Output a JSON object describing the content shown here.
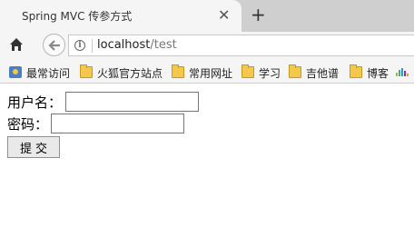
{
  "tab": {
    "title": "Spring MVC 传参方式",
    "close_glyph": "✕",
    "new_tab_glyph": "+"
  },
  "nav": {
    "url_host": "localhost",
    "url_path": "/test",
    "info_glyph": "i"
  },
  "bookmarks": [
    {
      "label": "最常访问",
      "icon": "reading-list-icon"
    },
    {
      "label": "火狐官方站点",
      "icon": "folder-icon"
    },
    {
      "label": "常用网址",
      "icon": "folder-icon"
    },
    {
      "label": "学习",
      "icon": "folder-icon"
    },
    {
      "label": "吉他谱",
      "icon": "folder-icon"
    },
    {
      "label": "博客",
      "icon": "folder-icon"
    }
  ],
  "form": {
    "username_label": "用户名：",
    "username_value": "",
    "password_label": "密码：",
    "password_value": "",
    "submit_label": "提交"
  },
  "colors": {
    "tabstrip": "#cfcfcf",
    "toolbar": "#f5f5f5",
    "folder": "#f3c84c"
  }
}
